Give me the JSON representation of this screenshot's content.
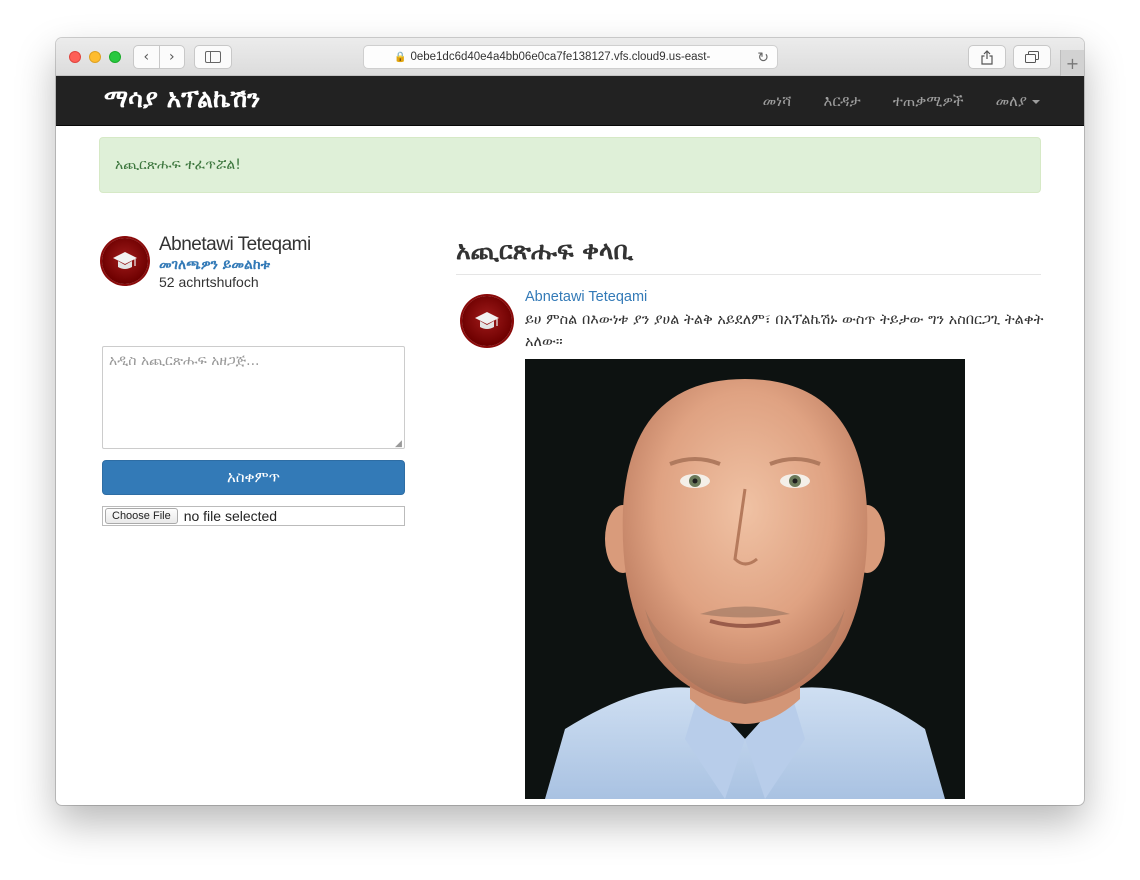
{
  "browser": {
    "url": "0ebe1dc6d40e4a4bb06e0ca7fe138127.vfs.cloud9.us-east-"
  },
  "navbar": {
    "brand": "ማሳያ አፕልኬሽን",
    "links": [
      "መነሻ",
      "እርዳታ",
      "ተጠቃሚዎች",
      "መለያ"
    ]
  },
  "alert": {
    "message": "አጪርጽሑፍ ተፈጥሯል!",
    "color": "#dff0d8"
  },
  "profile": {
    "name": "Abnetawi Teteqami",
    "edit_link": "መገለጫዎን ይመልከቱ",
    "count": "52 achrtshufoch"
  },
  "compose": {
    "placeholder": "አዲስ አጪርጽሑፍ አዘጋጅ...",
    "submit_label": "አስቀምጥ",
    "file_button": "Choose File",
    "file_status": "no file selected"
  },
  "feed": {
    "title": "አጪርጽሑፍ ቀላቢ",
    "posts": [
      {
        "author": "Abnetawi Teteqami",
        "body": "ይሀ ምስል በእውነቱ ያን ያሀል ትልቅ አይደለም፣ በአፕልኬሽኑ ውስጥ ትይታው ግን አስበርጋጊ ትልቀት አለው።"
      }
    ]
  },
  "colors": {
    "navbar": "#222222",
    "primary": "#337ab7",
    "avatar": "#8a0a0a"
  }
}
